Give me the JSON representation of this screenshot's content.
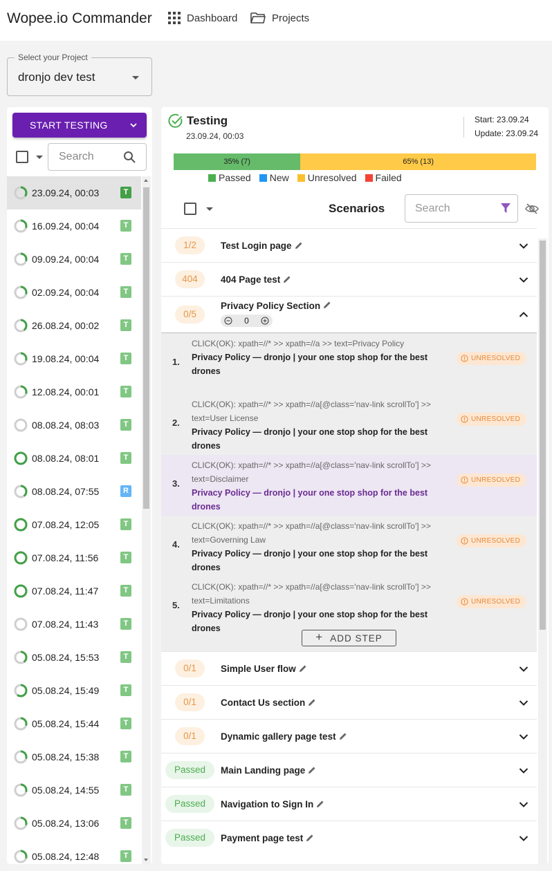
{
  "header": {
    "app_title": "Wopee.io Commander",
    "nav": [
      {
        "label": "Dashboard",
        "icon": "grid-icon"
      },
      {
        "label": "Projects",
        "icon": "folder-icon"
      }
    ]
  },
  "project_select": {
    "label": "Select your Project",
    "value": "dronjo dev test"
  },
  "left_panel": {
    "start_button": "START TESTING",
    "search_placeholder": "Search",
    "runs": [
      {
        "date": "23.09.24, 00:03",
        "badge": "T",
        "selected": true
      },
      {
        "date": "16.09.24, 00:04",
        "badge": "T"
      },
      {
        "date": "09.09.24, 00:04",
        "badge": "T"
      },
      {
        "date": "02.09.24, 00:04",
        "badge": "T"
      },
      {
        "date": "26.08.24, 00:02",
        "badge": "T"
      },
      {
        "date": "19.08.24, 00:04",
        "badge": "T"
      },
      {
        "date": "12.08.24, 00:01",
        "badge": "T"
      },
      {
        "date": "08.08.24, 08:03",
        "badge": "T"
      },
      {
        "date": "08.08.24, 08:01",
        "badge": "T"
      },
      {
        "date": "08.08.24, 07:55",
        "badge": "R"
      },
      {
        "date": "07.08.24, 12:05",
        "badge": "T"
      },
      {
        "date": "07.08.24, 11:56",
        "badge": "T"
      },
      {
        "date": "07.08.24, 11:47",
        "badge": "T"
      },
      {
        "date": "07.08.24, 11:43",
        "badge": "T"
      },
      {
        "date": "05.08.24, 15:53",
        "badge": "T"
      },
      {
        "date": "05.08.24, 15:49",
        "badge": "T"
      },
      {
        "date": "05.08.24, 15:44",
        "badge": "T"
      },
      {
        "date": "05.08.24, 15:38",
        "badge": "T"
      },
      {
        "date": "05.08.24, 14:55",
        "badge": "T"
      },
      {
        "date": "05.08.24, 13:06",
        "badge": "T"
      },
      {
        "date": "05.08.24, 12:48",
        "badge": "T"
      }
    ]
  },
  "status": {
    "title": "Testing",
    "date": "23.09.24, 00:03",
    "start": "Start: 23.09.24",
    "update": "Update: 23.09.24",
    "progress": [
      {
        "label": "35% (7)",
        "fraction": 0.35,
        "color": "#66bb6a"
      },
      {
        "label": "65% (13)",
        "fraction": 0.65,
        "color": "#ffca48"
      }
    ],
    "legend": [
      {
        "label": "Passed",
        "color": "#4caf50"
      },
      {
        "label": "New",
        "color": "#2196f3"
      },
      {
        "label": "Unresolved",
        "color": "#fbc02d"
      },
      {
        "label": "Failed",
        "color": "#f44336"
      }
    ]
  },
  "scenarios_header": {
    "title": "Scenarios",
    "search_placeholder": "Search"
  },
  "scenarios_top": [
    {
      "pill": "1/2",
      "name": "Test Login page"
    },
    {
      "pill": "404",
      "name": "404 Page test"
    }
  ],
  "expanded": {
    "pill": "0/5",
    "name": "Privacy Policy Section",
    "counter_value": "0",
    "add_step": "ADD STEP",
    "steps": [
      {
        "num": "1.",
        "cmd": "CLICK(OK): xpath=//* >> xpath=//a >> text=Privacy Policy",
        "page": "Privacy Policy — dronjo | your one stop shop for the best drones",
        "tag": "UNRESOLVED"
      },
      {
        "num": "2.",
        "cmd": "CLICK(OK): xpath=//* >> xpath=//a[@class='nav-link scrollTo'] >> text=User License",
        "page": "Privacy Policy — dronjo | your one stop shop for the best drones",
        "tag": "UNRESOLVED"
      },
      {
        "num": "3.",
        "cmd": "CLICK(OK): xpath=//* >> xpath=//a[@class='nav-link scrollTo'] >> text=Disclaimer",
        "page": "Privacy Policy — dronjo | your one stop shop for the best drones",
        "tag": "UNRESOLVED"
      },
      {
        "num": "4.",
        "cmd": "CLICK(OK): xpath=//* >> xpath=//a[@class='nav-link scrollTo'] >> text=Governing Law",
        "page": "Privacy Policy — dronjo | your one stop shop for the best drones",
        "tag": "UNRESOLVED"
      },
      {
        "num": "5.",
        "cmd": "CLICK(OK): xpath=//* >> xpath=//a[@class='nav-link scrollTo'] >> text=Limitations",
        "page": "Privacy Policy — dronjo | your one stop shop for the best drones",
        "tag": "UNRESOLVED"
      }
    ]
  },
  "scenarios_bottom": [
    {
      "pill": "0/1",
      "name": "Simple User flow"
    },
    {
      "pill": "0/1",
      "name": "Contact Us section"
    },
    {
      "pill": "0/1",
      "name": "Dynamic gallery page test"
    },
    {
      "pill": "Passed",
      "name": "Main Landing page",
      "passed": true
    },
    {
      "pill": "Passed",
      "name": "Navigation to Sign In",
      "passed": true
    },
    {
      "pill": "Passed",
      "name": "Payment page test",
      "passed": true
    }
  ]
}
